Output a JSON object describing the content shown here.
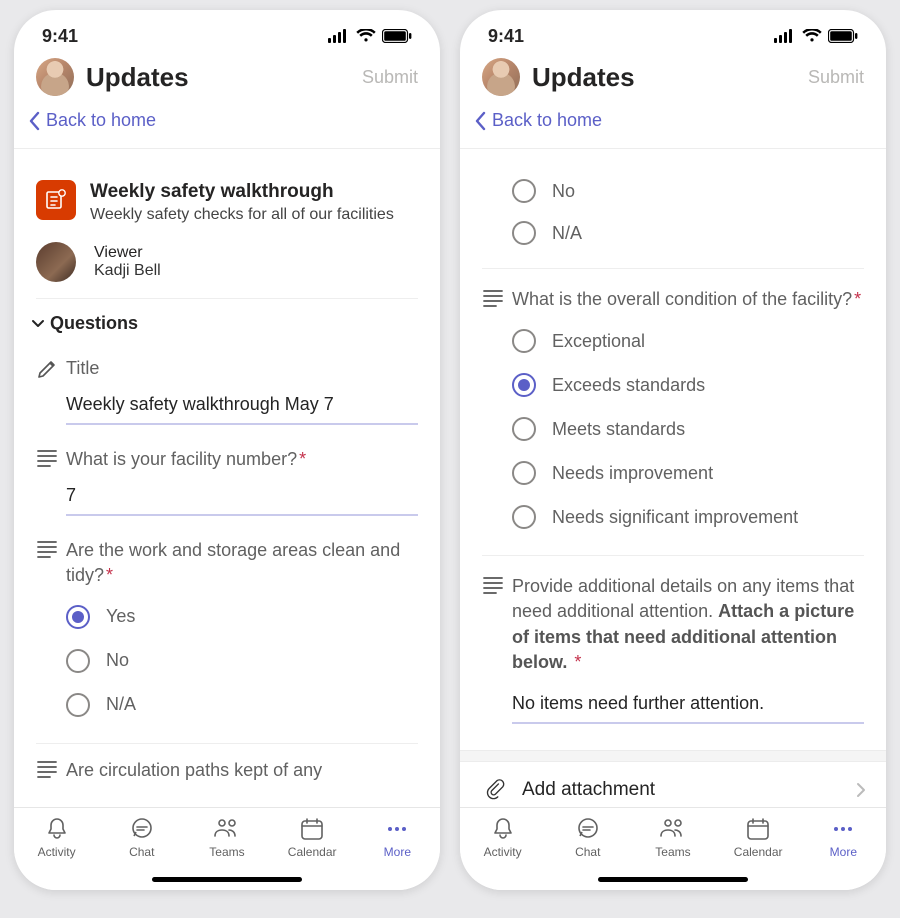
{
  "status_bar": {
    "time": "9:41"
  },
  "header": {
    "title": "Updates",
    "submit": "Submit"
  },
  "back_link": "Back to home",
  "template_card": {
    "title": "Weekly safety walkthrough",
    "subtitle": "Weekly safety checks for all of our facilities"
  },
  "viewer": {
    "role": "Viewer",
    "name": "Kadji Bell"
  },
  "questions_section": "Questions",
  "p1": {
    "title_label": "Title",
    "title_value": "Weekly safety walkthrough May 7",
    "facility_label": "What is your facility number?",
    "facility_value": "7",
    "clean_label": "Are the work and storage areas clean and tidy?",
    "clean_options": [
      "Yes",
      "No",
      "N/A"
    ],
    "clean_selected": 0,
    "cutoff": "Are circulation paths kept of any"
  },
  "p2": {
    "prev_options": [
      "No",
      "N/A"
    ],
    "condition_label": "What is the overall condition of the facility?",
    "condition_options": [
      "Exceptional",
      "Exceeds standards",
      "Meets standards",
      "Needs improvement",
      "Needs significant improvement"
    ],
    "condition_selected": 1,
    "details_text_a": "Provide additional details on any items that need additional attention. ",
    "details_text_b": "Attach a picture of items that need additional attention below.",
    "details_answer": "No items need further attention.",
    "attach": "Add attachment"
  },
  "nav": {
    "activity": "Activity",
    "chat": "Chat",
    "teams": "Teams",
    "calendar": "Calendar",
    "more": "More"
  }
}
